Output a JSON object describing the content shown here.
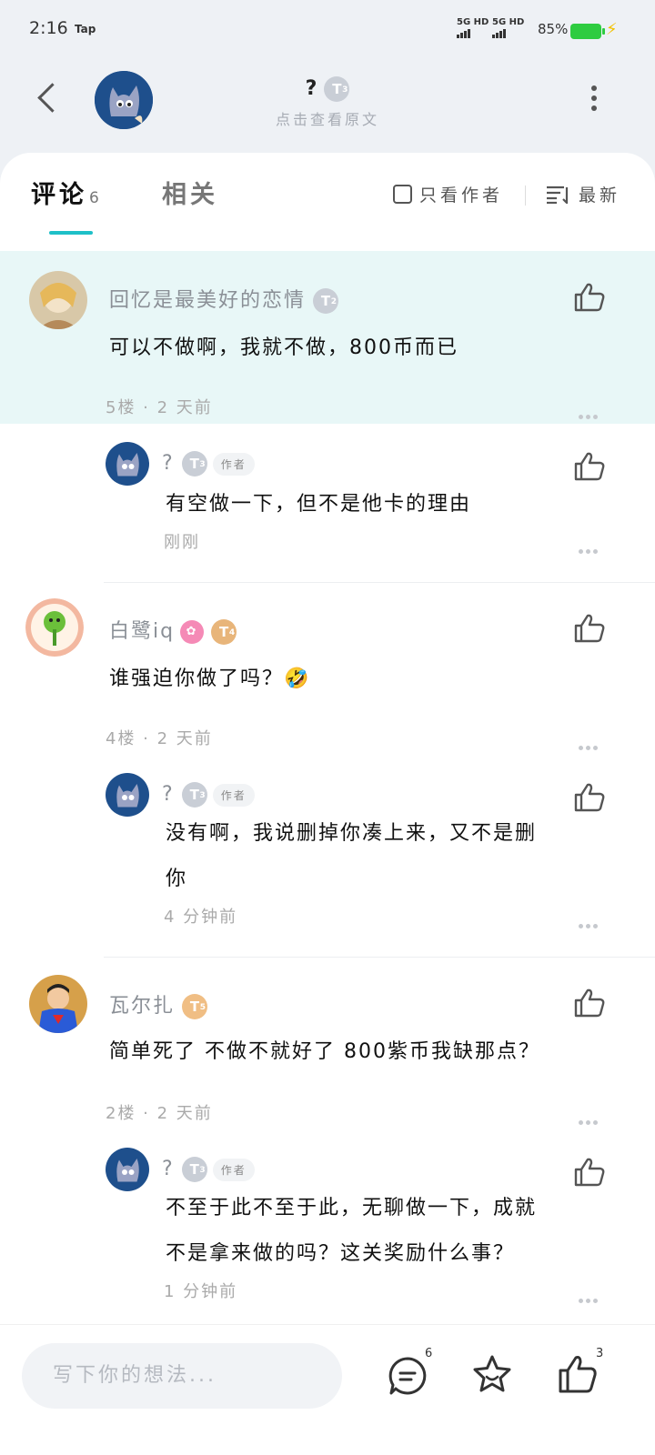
{
  "status_bar": {
    "time": "2:16",
    "app": "Tap",
    "signal1": "5G HD",
    "signal2": "5G HD",
    "battery": "85%"
  },
  "header": {
    "title": "?",
    "title_level": "3",
    "subtitle": "点击查看原文"
  },
  "tabs": {
    "comments_label": "评论",
    "comments_count": "6",
    "related_label": "相关",
    "author_only_label": "只看作者",
    "sort_label": "最新"
  },
  "comments": [
    {
      "user": "回忆是最美好的恋情",
      "level": "2",
      "text": "可以不做啊，我就不做，800币而已",
      "meta": "5楼 · 2 天前",
      "reply": {
        "user": "?",
        "level": "3",
        "tag": "作者",
        "text": "有空做一下，但不是他卡的理由",
        "time": "刚刚"
      }
    },
    {
      "user": "白鹭iq",
      "level": "4",
      "text": "谁强迫你做了吗？🤣",
      "meta": "4楼 · 2 天前",
      "reply": {
        "user": "?",
        "level": "3",
        "tag": "作者",
        "text_line1": "没有啊，我说删掉你凑上来，又不是删",
        "text_line2": "你",
        "time": "4 分钟前"
      }
    },
    {
      "user": "瓦尔扎",
      "level": "5",
      "text": "简单死了 不做不就好了 800紫币我缺那点？",
      "meta": "2楼 · 2 天前",
      "reply": {
        "user": "?",
        "level": "3",
        "tag": "作者",
        "text_line1": "不至于此不至于此，无聊做一下，成就",
        "text_line2": "不是拿来做的吗？这关奖励什么事？",
        "time": "1 分钟前"
      }
    }
  ],
  "bottom_bar": {
    "input_placeholder": "写下你的想法...",
    "comment_count": "6",
    "like_count": "3"
  },
  "colors": {
    "accent": "#1ec0c8",
    "highlight_bg": "#e8f7f7",
    "battery": "#2ecc40"
  }
}
